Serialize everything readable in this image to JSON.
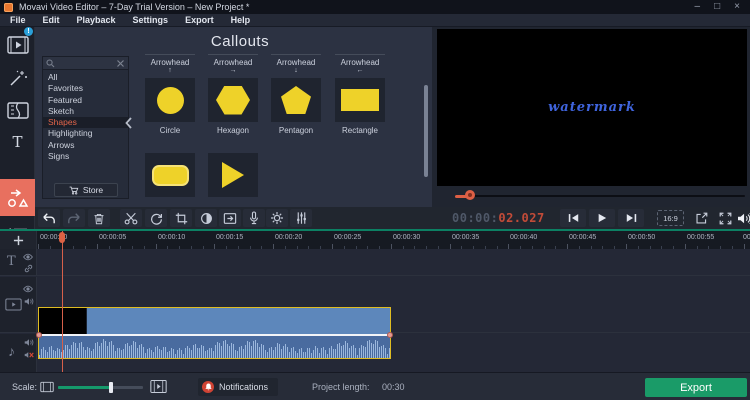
{
  "window": {
    "title": "Movavi Video Editor – 7-Day Trial Version – New Project *",
    "controls": {
      "minimize": "–",
      "maximize": "□",
      "close": "×"
    }
  },
  "menu": {
    "items": [
      "File",
      "Edit",
      "Playback",
      "Settings",
      "Export",
      "Help"
    ]
  },
  "sidebar": {
    "tools": [
      "media-import",
      "filters",
      "transitions",
      "titles",
      "callouts",
      "timeline-list"
    ],
    "selected_tool": "callouts",
    "titles_glyph": "T"
  },
  "callouts": {
    "title": "Callouts",
    "search": {
      "value": "",
      "placeholder": ""
    },
    "categories": [
      "All",
      "Favorites",
      "Featured",
      "Sketch",
      "Shapes",
      "Highlighting",
      "Arrows",
      "Signs"
    ],
    "selected_category": "Shapes",
    "store_label": "Store",
    "items": [
      {
        "header": "Arrowhead",
        "arrow": "↑",
        "shape": "circle",
        "label": "Circle"
      },
      {
        "header": "Arrowhead",
        "arrow": "→",
        "shape": "hexagon",
        "label": "Hexagon"
      },
      {
        "header": "Arrowhead",
        "arrow": "↓",
        "shape": "pentagon",
        "label": "Pentagon"
      },
      {
        "header": "Arrowhead",
        "arrow": "←",
        "shape": "rectangle",
        "label": "Rectangle"
      }
    ],
    "more_shapes": [
      "rounded-rectangle",
      "triangle"
    ]
  },
  "preview": {
    "watermark_text": "watermark",
    "progress_fraction": 0.05
  },
  "toolbar": {
    "buttons": [
      "undo",
      "redo",
      "delete",
      "split",
      "rotate",
      "crop",
      "color-adjustments",
      "pan-zoom",
      "record-audio",
      "clip-properties",
      "audio-properties"
    ]
  },
  "transport": {
    "timecode_prefix": "00:00:",
    "timecode_value": "02.027",
    "aspect_ratio": "16:9"
  },
  "timeline": {
    "ruler_labels": [
      "00:00:00",
      "00:00:05",
      "00:00:10",
      "00:00:15",
      "00:00:20",
      "00:00:25",
      "00:00:30",
      "00:00:35",
      "00:00:40",
      "00:00:45",
      "00:00:50",
      "00:00:55",
      "00"
    ],
    "clip_selected": true
  },
  "statusbar": {
    "scale_label": "Scale:",
    "notifications_label": "Notifications",
    "project_length_label": "Project length:",
    "project_length_value": "00:30",
    "export_label": "Export"
  },
  "colors": {
    "accent_coral": "#e8705f",
    "accent_yellow": "#eed229",
    "accent_teal": "#0c8063",
    "export_green": "#1a9b68",
    "playhead_red": "#dd5f45",
    "clip_blue": "#5d87bb",
    "watermark_blue": "#3f64dd",
    "timecode_red": "#c24b38"
  }
}
